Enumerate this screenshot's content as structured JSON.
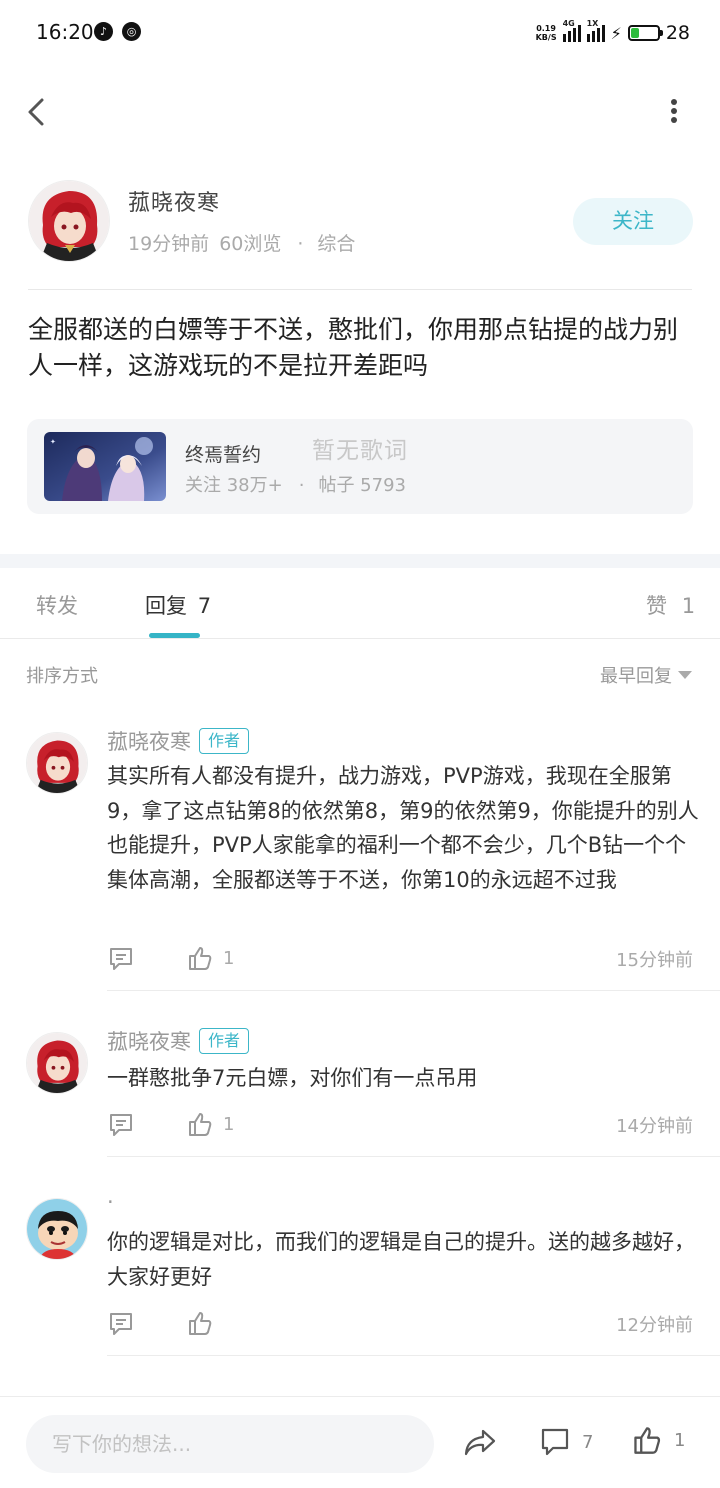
{
  "status_bar": {
    "time": "16:20",
    "net_speed_value": "0.19",
    "net_speed_unit": "KB/S",
    "signal1_label": "4G",
    "signal2_label": "1X",
    "battery_level": "28",
    "battery_fraction": 0.28,
    "notif_icons": [
      "notification-icon-a",
      "notification-icon-b"
    ]
  },
  "header": {
    "back_icon": "chevron-left-icon",
    "more_icon": "more-vertical-icon"
  },
  "post": {
    "author_name": "菰晓夜寒",
    "time_ago": "19分钟前",
    "views": "60浏览",
    "separator": "·",
    "category": "综合",
    "follow_label": "关注",
    "text": "全服都送的白嫖等于不送，憨批们，你用那点钻提的战力别人一样，这游戏玩的不是拉开差距吗"
  },
  "game_card": {
    "name": "终焉誓约",
    "watermark": "暂无歌词",
    "followers": "关注  38万+",
    "separator": "·",
    "posts": "帖子  5793"
  },
  "tabs": {
    "forward": "转发",
    "reply": "回复",
    "reply_count": "7",
    "like": "赞",
    "like_count": "1"
  },
  "sort": {
    "label": "排序方式",
    "selected": "最早回复"
  },
  "comments": [
    {
      "author": "菰晓夜寒",
      "badge": "作者",
      "text": "其实所有人都没有提升，战力游戏，PVP游戏，我现在全服第9，拿了这点钻第8的依然第8，第9的依然第9，你能提升的别人也能提升，PVP人家能拿的福利一个都不会少，几个B钻一个个集体高潮，全服都送等于不送，你第10的永远超不过我",
      "likes": "1",
      "time": "15分钟前"
    },
    {
      "author": "菰晓夜寒",
      "badge": "作者",
      "text": "一群憨批争7元白嫖，对你们有一点吊用",
      "likes": "1",
      "time": "14分钟前"
    },
    {
      "author": "·",
      "badge": "",
      "text": "你的逻辑是对比，而我们的逻辑是自己的提升。送的越多越好，大家好更好",
      "likes": "",
      "time": "12分钟前"
    }
  ],
  "bottom_bar": {
    "input_placeholder": "写下你的想法...",
    "comment_count": "7",
    "like_count": "1"
  },
  "colors": {
    "accent": "#35b4c6",
    "follow_bg": "#eaf7fa",
    "muted_text": "#aaaaaa",
    "card_bg": "#f4f5f7"
  }
}
